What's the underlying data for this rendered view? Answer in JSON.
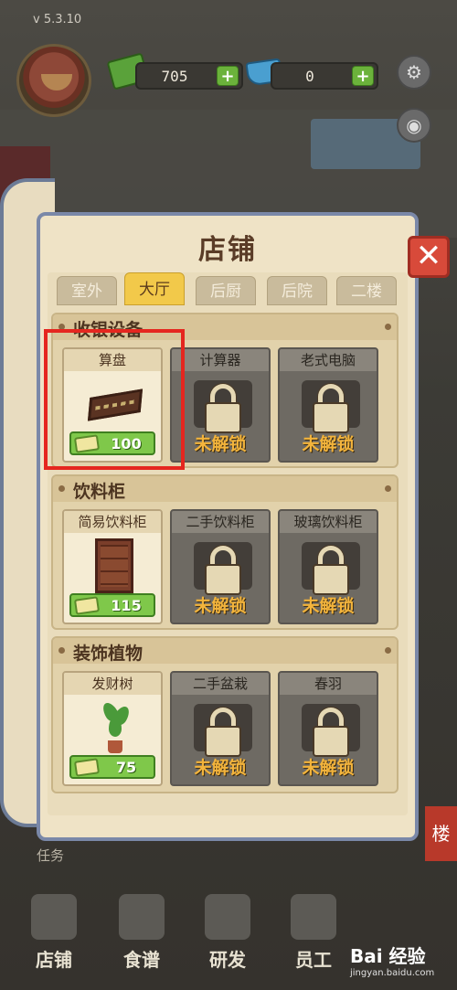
{
  "version": "v 5.3.10",
  "resources": {
    "cash": "705",
    "gems": "0",
    "add_symbol": "+"
  },
  "panel": {
    "title": "店铺",
    "close_symbol": "✕"
  },
  "tabs": [
    {
      "label": "室外",
      "active": false
    },
    {
      "label": "大厅",
      "active": true
    },
    {
      "label": "后厨",
      "active": false
    },
    {
      "label": "后院",
      "active": false
    },
    {
      "label": "二楼",
      "active": false
    }
  ],
  "categories": [
    {
      "title": "收银设备",
      "items": [
        {
          "name": "算盘",
          "price": "100",
          "locked": false
        },
        {
          "name": "计算器",
          "status": "未解锁",
          "locked": true
        },
        {
          "name": "老式电脑",
          "status": "未解锁",
          "locked": true
        }
      ]
    },
    {
      "title": "饮料柜",
      "items": [
        {
          "name": "简易饮料柜",
          "price": "115",
          "locked": false
        },
        {
          "name": "二手饮料柜",
          "status": "未解锁",
          "locked": true
        },
        {
          "name": "玻璃饮料柜",
          "status": "未解锁",
          "locked": true
        }
      ]
    },
    {
      "title": "装饰植物",
      "items": [
        {
          "name": "发财树",
          "price": "75",
          "locked": false
        },
        {
          "name": "二手盆栽",
          "status": "未解锁",
          "locked": true
        },
        {
          "name": "春羽",
          "status": "未解锁",
          "locked": true
        }
      ]
    }
  ],
  "task_label": "任务",
  "side_tab": "楼",
  "bottom_nav": [
    {
      "label": "店铺",
      "icon": "shop-icon"
    },
    {
      "label": "食谱",
      "icon": "recipe-book-icon"
    },
    {
      "label": "研发",
      "icon": "cooking-pot-icon"
    },
    {
      "label": "员工",
      "icon": "staff-icon"
    }
  ],
  "watermark": {
    "brand": "Bai 经验",
    "url": "jingyan.baidu.com"
  },
  "colors": {
    "highlight": "#e5261f",
    "active_tab": "#f2c94a",
    "price_green": "#7fc84a",
    "lock_text": "#f3b43c"
  }
}
